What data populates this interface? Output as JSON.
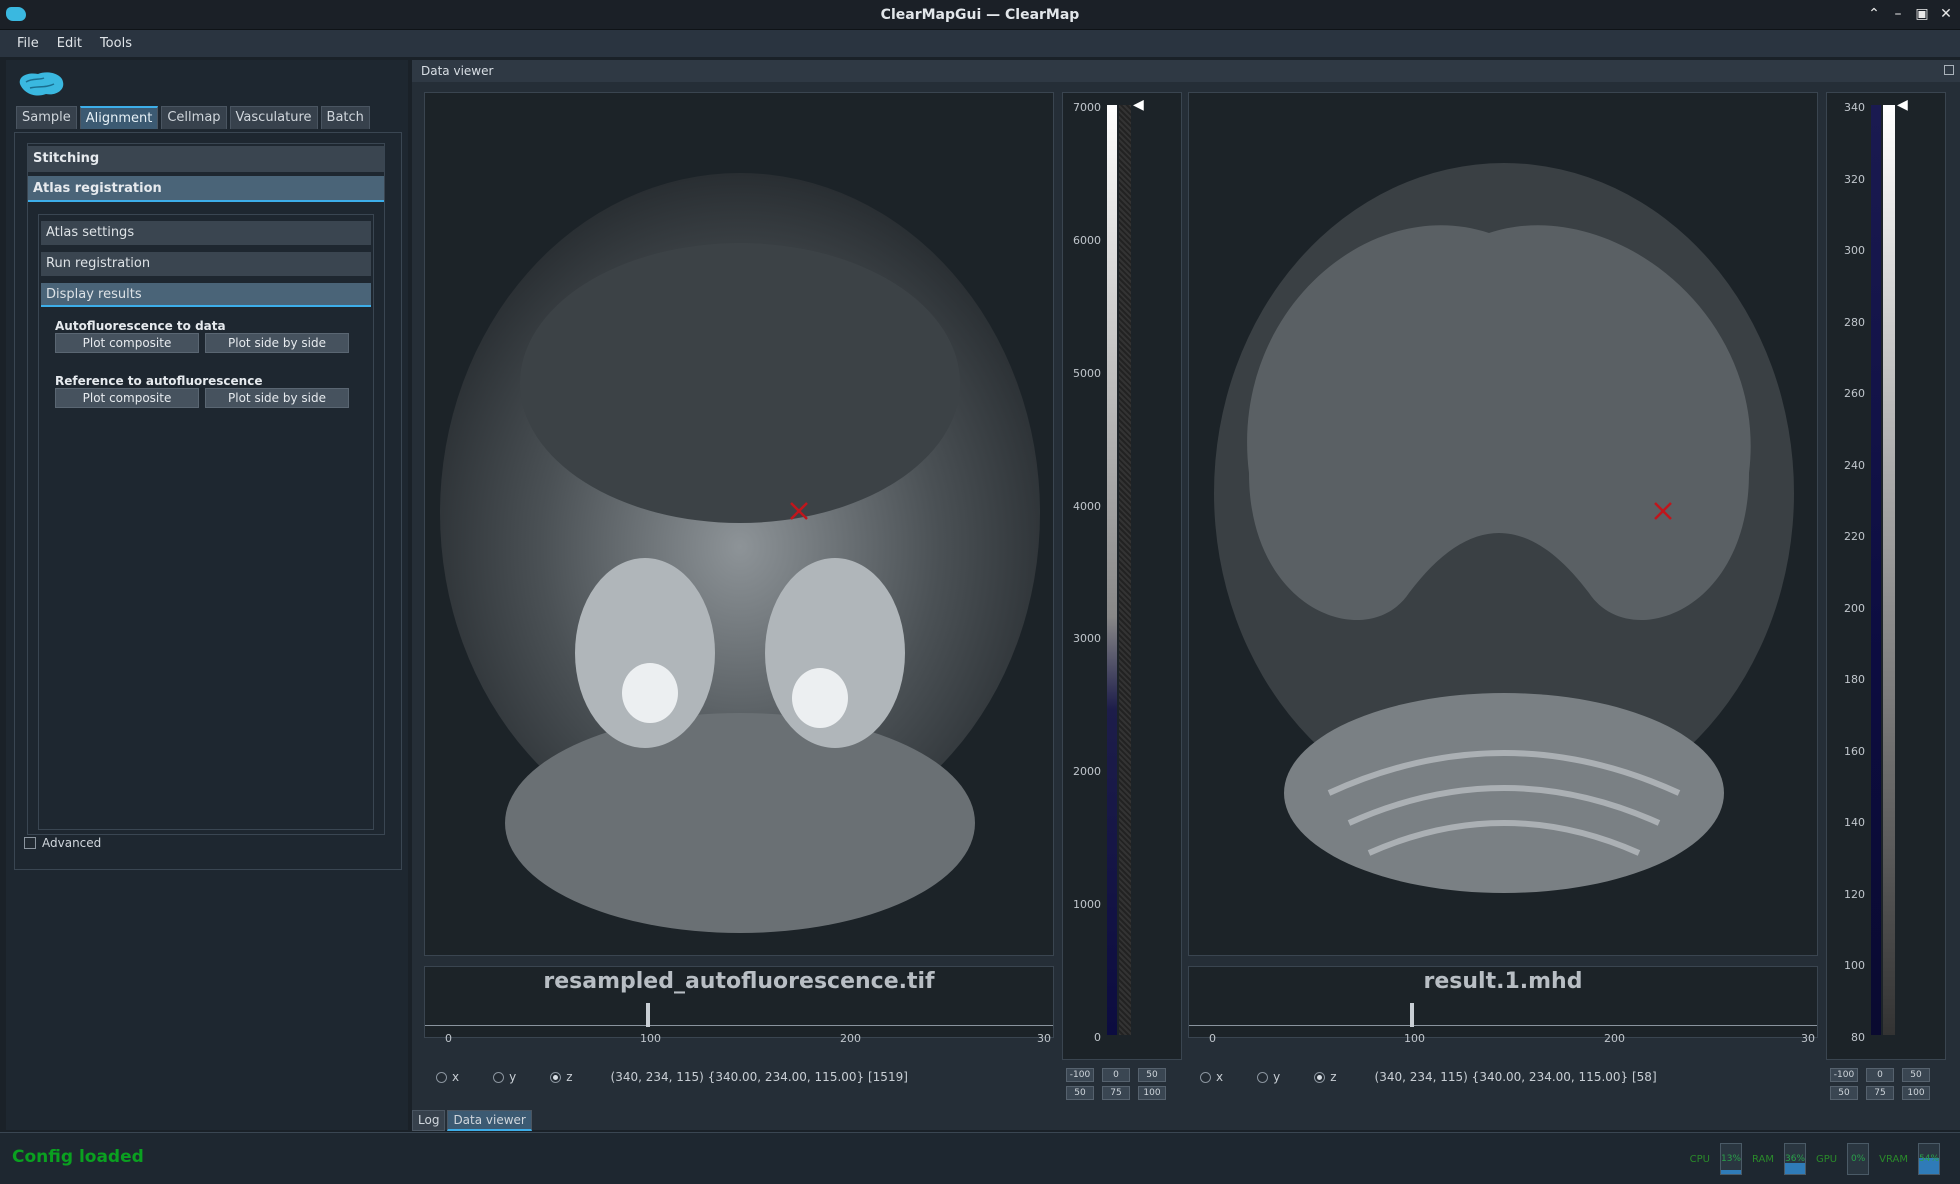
{
  "window": {
    "title": "ClearMapGui — ClearMap"
  },
  "menu": [
    "File",
    "Edit",
    "Tools"
  ],
  "tabs": [
    "Sample",
    "Alignment",
    "Cellmap",
    "Vasculature",
    "Batch"
  ],
  "active_tab": "Alignment",
  "toolbox": {
    "stitching": "Stitching",
    "atlas_registration": "Atlas registration",
    "sub_sections": [
      "Atlas settings",
      "Run registration",
      "Display results"
    ],
    "group1_label": "Autofluorescence to data",
    "group2_label": "Reference to autofluorescence",
    "plot_composite": "Plot composite",
    "plot_side_by_side": "Plot side by side",
    "advanced": "Advanced"
  },
  "viewer": {
    "header": "Data viewer",
    "left": {
      "filename": "resampled_autofluorescence.tif",
      "ticks": [
        "0",
        "100",
        "200",
        "30"
      ],
      "coords": "(340, 234, 115) {340.00, 234.00, 115.00} [1519]",
      "colorbar_ticks": [
        "7000",
        "6000",
        "5000",
        "4000",
        "3000",
        "2000",
        "1000",
        "0"
      ],
      "slice_fraction": 0.38
    },
    "right": {
      "filename": "result.1.mhd",
      "ticks": [
        "0",
        "100",
        "200",
        "30"
      ],
      "coords": "(340, 234, 115) {340.00, 234.00, 115.00} [58]",
      "colorbar_ticks": [
        "340",
        "320",
        "300",
        "280",
        "260",
        "240",
        "220",
        "200",
        "180",
        "160",
        "140",
        "120",
        "100",
        "80"
      ],
      "slice_fraction": 0.38
    },
    "axes": [
      "x",
      "y",
      "z"
    ],
    "selected_axis": "z",
    "cb_buttons": [
      "-100",
      "0",
      "50",
      "50",
      "75",
      "100"
    ]
  },
  "bottom_tabs": [
    "Log",
    "Data viewer"
  ],
  "active_bottom_tab": "Data viewer",
  "status": {
    "message": "Config loaded",
    "meters": [
      {
        "label": "CPU",
        "value": "13%",
        "fill": 0.13
      },
      {
        "label": "RAM",
        "value": "36%",
        "fill": 0.36
      },
      {
        "label": "GPU",
        "value": "0%",
        "fill": 0.0
      },
      {
        "label": "VRAM",
        "value": "54%",
        "fill": 0.54
      }
    ]
  },
  "colors": {
    "accent": "#3daee9",
    "status_green": "#0aa020",
    "cursor_x": "#c0161c"
  }
}
